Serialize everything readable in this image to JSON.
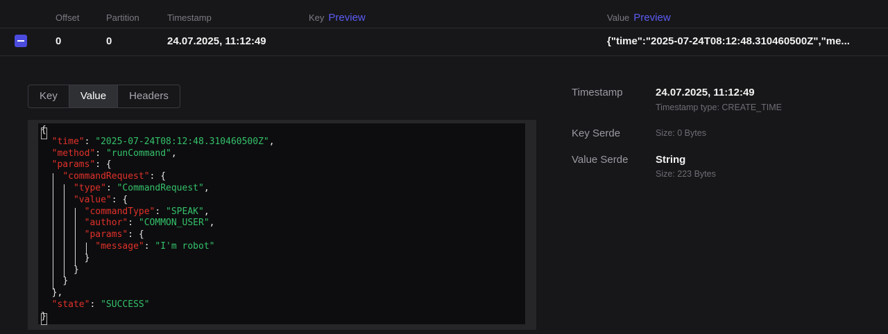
{
  "columns": {
    "offset": "Offset",
    "partition": "Partition",
    "timestamp": "Timestamp",
    "key": "Key",
    "key_preview": "Preview",
    "value": "Value",
    "value_preview": "Preview"
  },
  "message": {
    "offset": "0",
    "partition": "0",
    "timestamp": "24.07.2025, 11:12:49",
    "value_preview": "{\"time\":\"2025-07-24T08:12:48.310460500Z\",\"me..."
  },
  "tabs": [
    "Key",
    "Value",
    "Headers"
  ],
  "active_tab": "Value",
  "json_lines": [
    {
      "indent": "",
      "parts": [
        [
          "p",
          "{"
        ]
      ]
    },
    {
      "indent": "  ",
      "parts": [
        [
          "k",
          "\"time\""
        ],
        [
          "p",
          ": "
        ],
        [
          "s",
          "\"2025-07-24T08:12:48.310460500Z\""
        ],
        [
          "p",
          ","
        ]
      ]
    },
    {
      "indent": "  ",
      "parts": [
        [
          "k",
          "\"method\""
        ],
        [
          "p",
          ": "
        ],
        [
          "s",
          "\"runCommand\""
        ],
        [
          "p",
          ","
        ]
      ]
    },
    {
      "indent": "  ",
      "parts": [
        [
          "k",
          "\"params\""
        ],
        [
          "p",
          ": {"
        ]
      ]
    },
    {
      "indent": "    ",
      "parts": [
        [
          "k",
          "\"commandRequest\""
        ],
        [
          "p",
          ": {"
        ]
      ]
    },
    {
      "indent": "      ",
      "parts": [
        [
          "k",
          "\"type\""
        ],
        [
          "p",
          ": "
        ],
        [
          "s",
          "\"CommandRequest\""
        ],
        [
          "p",
          ","
        ]
      ]
    },
    {
      "indent": "      ",
      "parts": [
        [
          "k",
          "\"value\""
        ],
        [
          "p",
          ": {"
        ]
      ]
    },
    {
      "indent": "        ",
      "parts": [
        [
          "k",
          "\"commandType\""
        ],
        [
          "p",
          ": "
        ],
        [
          "s",
          "\"SPEAK\""
        ],
        [
          "p",
          ","
        ]
      ]
    },
    {
      "indent": "        ",
      "parts": [
        [
          "k",
          "\"author\""
        ],
        [
          "p",
          ": "
        ],
        [
          "s",
          "\"COMMON_USER\""
        ],
        [
          "p",
          ","
        ]
      ]
    },
    {
      "indent": "        ",
      "parts": [
        [
          "k",
          "\"params\""
        ],
        [
          "p",
          ": {"
        ]
      ]
    },
    {
      "indent": "          ",
      "parts": [
        [
          "k",
          "\"message\""
        ],
        [
          "p",
          ": "
        ],
        [
          "s",
          "\"I'm robot\""
        ]
      ]
    },
    {
      "indent": "        ",
      "parts": [
        [
          "p",
          "}"
        ]
      ]
    },
    {
      "indent": "      ",
      "parts": [
        [
          "p",
          "}"
        ]
      ]
    },
    {
      "indent": "    ",
      "parts": [
        [
          "p",
          "}"
        ]
      ]
    },
    {
      "indent": "  ",
      "parts": [
        [
          "p",
          "},"
        ]
      ]
    },
    {
      "indent": "  ",
      "parts": [
        [
          "k",
          "\"state\""
        ],
        [
          "p",
          ": "
        ],
        [
          "s",
          "\"SUCCESS\""
        ]
      ]
    },
    {
      "indent": "",
      "parts": [
        [
          "p",
          "}"
        ]
      ]
    }
  ],
  "meta": {
    "timestamp_label": "Timestamp",
    "timestamp_value": "24.07.2025, 11:12:49",
    "timestamp_type": "Timestamp type: CREATE_TIME",
    "key_serde_label": "Key Serde",
    "key_size": "Size: 0 Bytes",
    "value_serde_label": "Value Serde",
    "value_serde_value": "String",
    "value_size": "Size: 223 Bytes"
  },
  "colors": {
    "accent": "#4b4bde",
    "link": "#5b5bf5",
    "json_key": "#e2312a",
    "json_string": "#34c16a"
  }
}
